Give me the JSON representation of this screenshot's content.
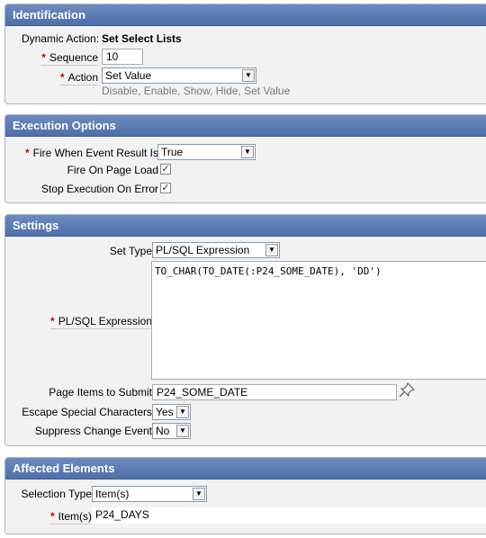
{
  "identification": {
    "title": "Identification",
    "dynamic_action_label": "Dynamic Action:",
    "dynamic_action_value": "Set Select Lists",
    "sequence_label": "Sequence",
    "sequence_value": "10",
    "action_label": "Action",
    "action_value": "Set Value",
    "action_hint": "Disable, Enable, Show, Hide, Set Value"
  },
  "execution_options": {
    "title": "Execution Options",
    "fire_when_label": "Fire When Event Result Is",
    "fire_when_value": "True",
    "fire_on_load_label": "Fire On Page Load",
    "fire_on_load_checked": true,
    "stop_exec_label": "Stop Execution On Error",
    "stop_exec_checked": true
  },
  "settings": {
    "title": "Settings",
    "set_type_label": "Set Type",
    "set_type_value": "PL/SQL Expression",
    "plsql_label": "PL/SQL Expression",
    "plsql_value": "TO_CHAR(TO_DATE(:P24_SOME_DATE), 'DD')",
    "page_items_label": "Page Items to Submit",
    "page_items_value": "P24_SOME_DATE",
    "escape_label": "Escape Special Characters",
    "escape_value": "Yes",
    "suppress_label": "Suppress Change Event",
    "suppress_value": "No"
  },
  "affected_elements": {
    "title": "Affected Elements",
    "selection_type_label": "Selection Type",
    "selection_type_value": "Item(s)",
    "items_label": "Item(s)",
    "items_value": "P24_DAYS"
  },
  "icons": {
    "required": "required-asterisk-icon",
    "dropdown": "chevron-down-icon",
    "checkbox": "checkmark-icon",
    "picker": "pushpin-icon"
  },
  "colors": {
    "header_gradient_top": "#6d8bbf",
    "header_gradient_bottom": "#4e6fa8",
    "panel_background": "#f2f2f2",
    "required_asterisk": "#cc0000"
  }
}
